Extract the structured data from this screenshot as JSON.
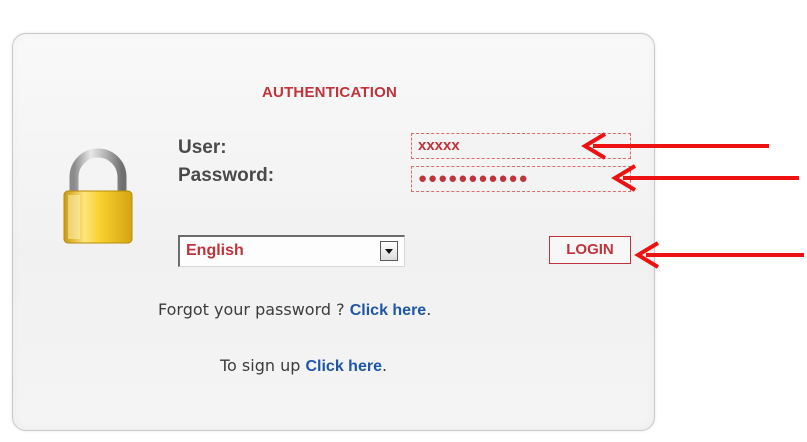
{
  "login_form": {
    "title": "AUTHENTICATION",
    "user_label": "User:",
    "password_label": "Password:",
    "user_value": "xxxxx",
    "password_masked": "●●●●●●●●●●●",
    "language_selected": "English",
    "login_button": "LOGIN",
    "forgot_text": "Forgot your password ? ",
    "forgot_link": "Click here",
    "forgot_suffix": ".",
    "signup_text": "To sign up ",
    "signup_link": "Click here",
    "signup_suffix": "."
  },
  "colors": {
    "accent_red": "#c0333a",
    "link_blue": "#1f56a6",
    "annotation_arrow": "#ee1111"
  },
  "icons": {
    "lock": "padlock-icon",
    "dropdown": "chevron-down-icon",
    "annotation": "red-arrow-icon"
  }
}
